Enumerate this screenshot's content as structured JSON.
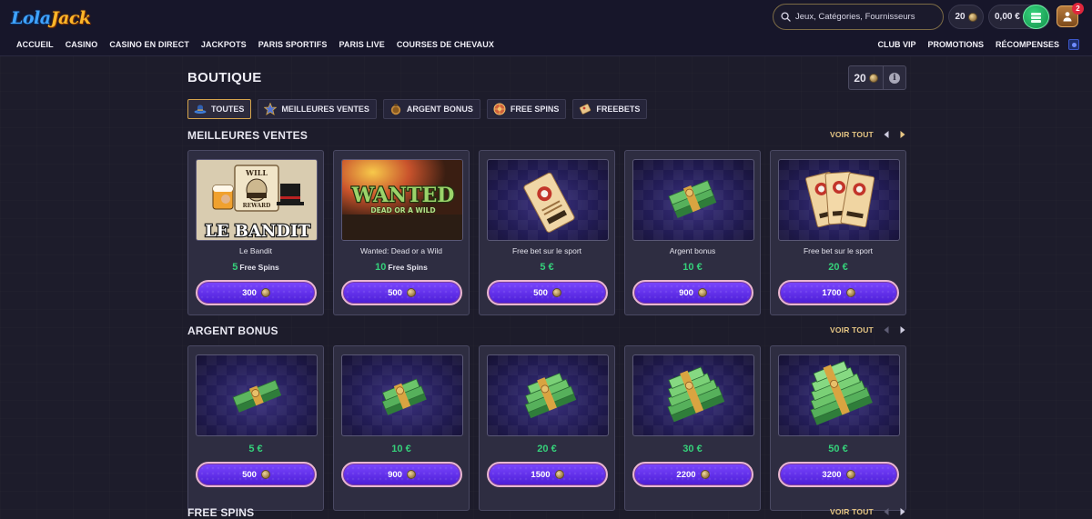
{
  "brand": {
    "logo_part1": "Lola",
    "logo_part2": "Jack"
  },
  "nav": {
    "main": [
      "ACCUEIL",
      "CASINO",
      "CASINO EN DIRECT",
      "JACKPOTS",
      "PARIS SPORTIFS",
      "PARIS LIVE",
      "COURSES DE CHEVAUX"
    ],
    "right": [
      "CLUB VIP",
      "PROMOTIONS",
      "RÉCOMPENSES"
    ]
  },
  "search": {
    "placeholder": "Jeux, Catégories, Fournisseurs"
  },
  "header": {
    "coins": "20",
    "balance": "0,00 €",
    "notifications": "2"
  },
  "page": {
    "title": "BOUTIQUE",
    "coin_balance": "20",
    "info_symbol": "i"
  },
  "filters": [
    {
      "label": "TOUTES",
      "icon": "hat-icon",
      "active": true
    },
    {
      "label": "MEILLEURES VENTES",
      "icon": "sheriff-star-icon",
      "active": false
    },
    {
      "label": "ARGENT BONUS",
      "icon": "money-bag-icon",
      "active": false
    },
    {
      "label": "FREE SPINS",
      "icon": "spin-wheel-icon",
      "active": false
    },
    {
      "label": "FREEBETS",
      "icon": "ticket-icon",
      "active": false
    }
  ],
  "sections": [
    {
      "title": "MEILLEURES VENTES",
      "voir_tout": "VOIR TOUT",
      "items": [
        {
          "name": "Le Bandit",
          "value": "5",
          "unit": "Free Spins",
          "price": "300",
          "image": "le-bandit-game-art"
        },
        {
          "name": "Wanted: Dead or a Wild",
          "value": "10",
          "unit": "Free Spins",
          "price": "500",
          "image": "wanted-game-art"
        },
        {
          "name": "Free bet sur le sport",
          "value": "5 €",
          "unit": "",
          "price": "500",
          "image": "freebet-ticket"
        },
        {
          "name": "Argent bonus",
          "value": "10 €",
          "unit": "",
          "price": "900",
          "image": "money-stack"
        },
        {
          "name": "Free bet sur le sport",
          "value": "20 €",
          "unit": "",
          "price": "1700",
          "image": "freebet-tickets"
        }
      ]
    },
    {
      "title": "ARGENT BONUS",
      "voir_tout": "VOIR TOUT",
      "items": [
        {
          "name": "",
          "value": "5 €",
          "unit": "",
          "price": "500",
          "image": "money-stack-1"
        },
        {
          "name": "",
          "value": "10 €",
          "unit": "",
          "price": "900",
          "image": "money-stack-2"
        },
        {
          "name": "",
          "value": "20 €",
          "unit": "",
          "price": "1500",
          "image": "money-stack-3"
        },
        {
          "name": "",
          "value": "30 €",
          "unit": "",
          "price": "2200",
          "image": "money-stack-4"
        },
        {
          "name": "",
          "value": "50 €",
          "unit": "",
          "price": "3200",
          "image": "money-stack-5"
        }
      ]
    },
    {
      "title": "FREE SPINS",
      "voir_tout": "VOIR TOUT",
      "items": []
    }
  ],
  "colors": {
    "accent_gold": "#d6a44c",
    "value_green": "#35d07a",
    "button_purple": "#5b2ae6",
    "background": "#1d1c2b"
  }
}
